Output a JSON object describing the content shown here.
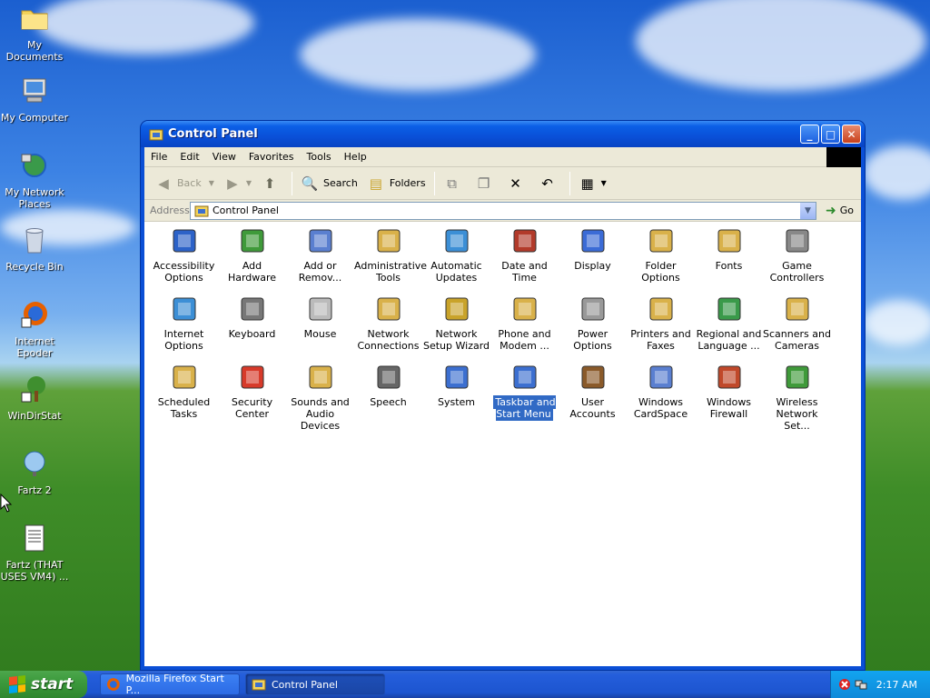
{
  "desktop": {
    "icons": [
      {
        "label": "My Documents"
      },
      {
        "label": "My Computer"
      },
      {
        "label": "My Network Places"
      },
      {
        "label": "Recycle Bin"
      },
      {
        "label": "Internet Epoder"
      },
      {
        "label": "WinDirStat"
      },
      {
        "label": "Fartz 2"
      },
      {
        "label": "Fartz (THAT USES VM4) ..."
      }
    ]
  },
  "window": {
    "title": "Control Panel",
    "menu": [
      "File",
      "Edit",
      "View",
      "Favorites",
      "Tools",
      "Help"
    ],
    "toolbar": {
      "back": "Back",
      "search": "Search",
      "folders": "Folders"
    },
    "address": {
      "label": "Address",
      "value": "Control Panel",
      "go": "Go"
    },
    "items": [
      {
        "label": "Accessibility Options"
      },
      {
        "label": "Add Hardware"
      },
      {
        "label": "Add or Remov..."
      },
      {
        "label": "Administrative Tools"
      },
      {
        "label": "Automatic Updates"
      },
      {
        "label": "Date and Time"
      },
      {
        "label": "Display"
      },
      {
        "label": "Folder Options"
      },
      {
        "label": "Fonts"
      },
      {
        "label": "Game Controllers"
      },
      {
        "label": "Internet Options"
      },
      {
        "label": "Keyboard"
      },
      {
        "label": "Mouse"
      },
      {
        "label": "Network Connections"
      },
      {
        "label": "Network Setup Wizard"
      },
      {
        "label": "Phone and Modem ..."
      },
      {
        "label": "Power Options"
      },
      {
        "label": "Printers and Faxes"
      },
      {
        "label": "Regional and Language ..."
      },
      {
        "label": "Scanners and Cameras"
      },
      {
        "label": "Scheduled Tasks"
      },
      {
        "label": "Security Center"
      },
      {
        "label": "Sounds and Audio Devices"
      },
      {
        "label": "Speech"
      },
      {
        "label": "System"
      },
      {
        "label": "Taskbar and Start Menu"
      },
      {
        "label": "User Accounts"
      },
      {
        "label": "Windows CardSpace"
      },
      {
        "label": "Windows Firewall"
      },
      {
        "label": "Wireless Network Set..."
      }
    ],
    "selected_item": "Taskbar and Start Menu"
  },
  "taskbar": {
    "start": "start",
    "tasks": [
      {
        "label": "Mozilla Firefox Start P..."
      },
      {
        "label": "Control Panel"
      }
    ],
    "clock": "2:17 AM"
  },
  "colors": {
    "titlebar": "#0a50d8",
    "selection": "#316ac5",
    "start_button": "#3c9a3c",
    "tray": "#0e8ad9"
  }
}
